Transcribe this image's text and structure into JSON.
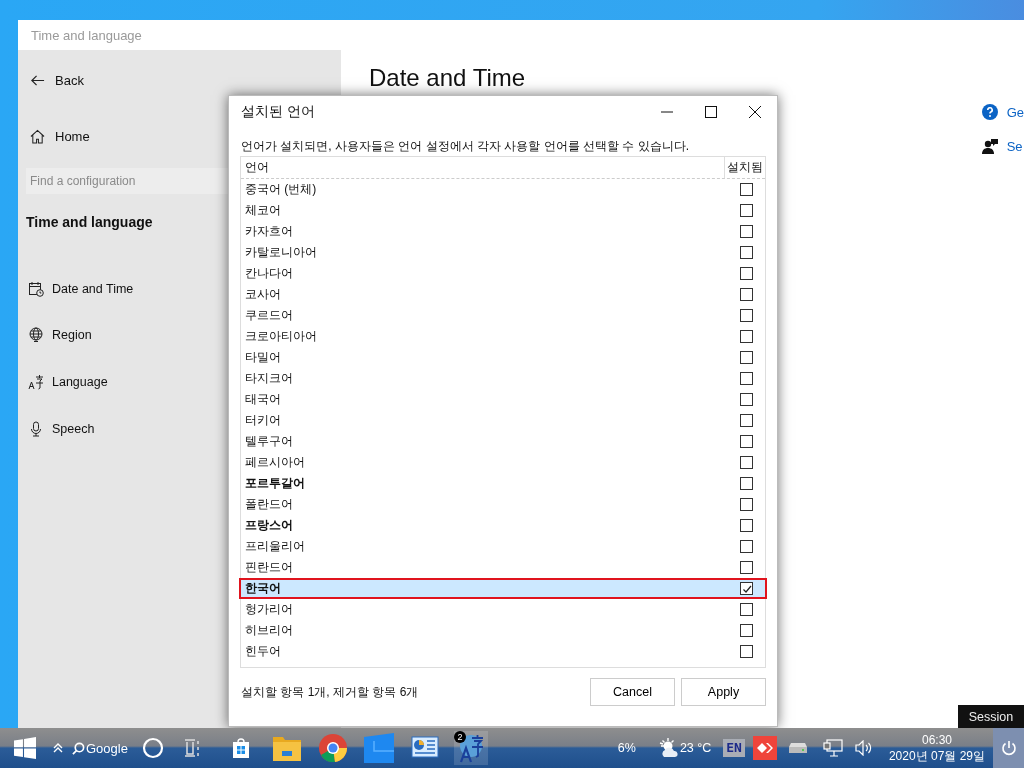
{
  "settings_window": {
    "title": "Time and language",
    "back": "Back",
    "home": "Home",
    "search": {
      "placeholder": "Find a configuration"
    },
    "section": "Time and language",
    "nav": [
      {
        "kind": "calendar",
        "label": "Date and Time"
      },
      {
        "kind": "globe",
        "label": "Region"
      },
      {
        "kind": "language",
        "label": "Language"
      },
      {
        "kind": "microphone",
        "label": "Speech"
      }
    ],
    "heading": "Date and Time",
    "links": [
      {
        "kind": "help",
        "label": "Ge"
      },
      {
        "kind": "person",
        "label": "Se"
      }
    ]
  },
  "dialog": {
    "title": "설치된 언어",
    "description": "언어가 설치되면, 사용자들은 언어 설정에서 각자 사용할 언어를 선택할 수 있습니다.",
    "columns": [
      "언어",
      "설치됨"
    ],
    "rows": [
      {
        "name": "중국어 (번체)",
        "installed": false,
        "emphasized": false,
        "selected": false
      },
      {
        "name": "체코어",
        "installed": false,
        "emphasized": false,
        "selected": false
      },
      {
        "name": "카자흐어",
        "installed": false,
        "emphasized": false,
        "selected": false
      },
      {
        "name": "카탈로니아어",
        "installed": false,
        "emphasized": false,
        "selected": false
      },
      {
        "name": "칸나다어",
        "installed": false,
        "emphasized": false,
        "selected": false
      },
      {
        "name": "코사어",
        "installed": false,
        "emphasized": false,
        "selected": false
      },
      {
        "name": "쿠르드어",
        "installed": false,
        "emphasized": false,
        "selected": false
      },
      {
        "name": "크로아티아어",
        "installed": false,
        "emphasized": false,
        "selected": false
      },
      {
        "name": "타밀어",
        "installed": false,
        "emphasized": false,
        "selected": false
      },
      {
        "name": "타지크어",
        "installed": false,
        "emphasized": false,
        "selected": false
      },
      {
        "name": "태국어",
        "installed": false,
        "emphasized": false,
        "selected": false
      },
      {
        "name": "터키어",
        "installed": false,
        "emphasized": false,
        "selected": false
      },
      {
        "name": "텔루구어",
        "installed": false,
        "emphasized": false,
        "selected": false
      },
      {
        "name": "페르시아어",
        "installed": false,
        "emphasized": false,
        "selected": false
      },
      {
        "name": "포르투갈어",
        "installed": false,
        "emphasized": true,
        "selected": false
      },
      {
        "name": "폴란드어",
        "installed": false,
        "emphasized": false,
        "selected": false
      },
      {
        "name": "프랑스어",
        "installed": false,
        "emphasized": true,
        "selected": false
      },
      {
        "name": "프리울리어",
        "installed": false,
        "emphasized": false,
        "selected": false
      },
      {
        "name": "핀란드어",
        "installed": false,
        "emphasized": false,
        "selected": false
      },
      {
        "name": "한국어",
        "installed": true,
        "emphasized": true,
        "selected": true
      },
      {
        "name": "헝가리어",
        "installed": false,
        "emphasized": false,
        "selected": false
      },
      {
        "name": "히브리어",
        "installed": false,
        "emphasized": false,
        "selected": false
      },
      {
        "name": "힌두어",
        "installed": false,
        "emphasized": false,
        "selected": false
      }
    ],
    "summary": "설치할 항목 1개, 제거할 항목 6개",
    "buttons": [
      "Cancel",
      "Apply"
    ]
  },
  "tooltip": "Session",
  "taskbar": {
    "search": "Google",
    "badge": "2",
    "battery": "6%",
    "temperature": "23 °C",
    "input": "EN",
    "time": "06:30",
    "date": "2020년 07월 29일"
  }
}
